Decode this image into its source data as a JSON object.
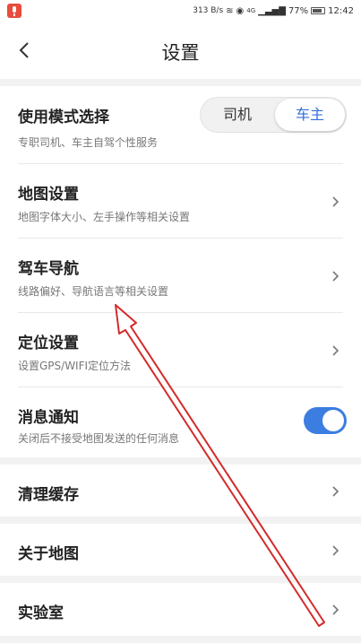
{
  "status_bar": {
    "speed": "313 B/s",
    "network": "4G",
    "battery": "77%",
    "time": "12:42",
    "icons": [
      "mic-icon",
      "wifi-icon",
      "location-icon",
      "signal-icon",
      "battery-icon"
    ]
  },
  "header": {
    "title": "设置",
    "back_icon": "chevron-left-icon"
  },
  "mode_select": {
    "title": "使用模式选择",
    "subtitle": "专职司机、车主自驾个性服务",
    "options": [
      "司机",
      "车主"
    ],
    "selected": "车主"
  },
  "settings": [
    {
      "title": "地图设置",
      "subtitle": "地图字体大小、左手操作等相关设置"
    },
    {
      "title": "驾车导航",
      "subtitle": "线路偏好、导航语言等相关设置"
    },
    {
      "title": "定位设置",
      "subtitle": "设置GPS/WIFI定位方法"
    },
    {
      "title": "消息通知",
      "subtitle": "关闭后不接受地图发送的任何消息",
      "toggle": true
    }
  ],
  "more": [
    {
      "title": "清理缓存"
    },
    {
      "title": "关于地图"
    },
    {
      "title": "实验室"
    }
  ],
  "colors": {
    "accent": "#3b7de0",
    "annotation_arrow": "#d32b2b"
  }
}
